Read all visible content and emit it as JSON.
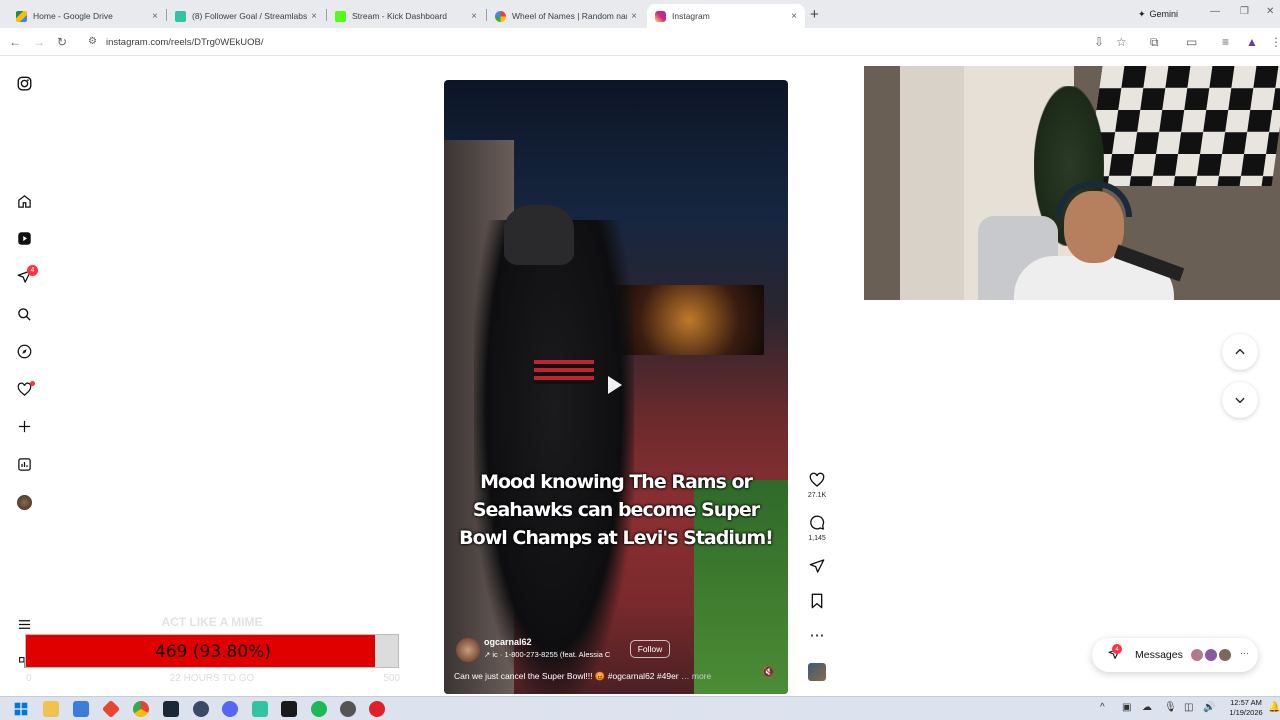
{
  "browser": {
    "tabs": [
      {
        "label": "Home - Google Drive",
        "close": "×",
        "favicon_color": "#1e8e3e"
      },
      {
        "label": "(8) Follower Goal / Streamlabs",
        "close": "×",
        "favicon_color": "#31c3a2"
      },
      {
        "label": "Stream - Kick Dashboard",
        "close": "×",
        "favicon_color": "#53fc18"
      },
      {
        "label": "Wheel of Names | Random nam",
        "close": "×",
        "favicon_color": "#4285f4"
      },
      {
        "label": "Instagram",
        "close": "×",
        "favicon_color": "#e1306c"
      }
    ],
    "new_tab": "+",
    "gemini_label": "Gemini",
    "url": "instagram.com/reels/DTrg0WEkUOB/"
  },
  "instagram": {
    "nav_badge_count": "4",
    "reel": {
      "overlay_text": "Mood knowing The Rams or Seahawks can become Super Bowl Champs at Levi's Stadium!",
      "username": "ogcarnal62",
      "audio": "↗ ic · 1-800-273-8255 (feat. Alessia C",
      "follow_label": "Follow",
      "caption": "Can we just cancel the Super Bowl!!! 😡 #ogcarnal62 #49er",
      "more_label": "… more"
    },
    "actions": {
      "likes": "27.1K",
      "comments": "1,145"
    },
    "messages": {
      "label": "Messages",
      "badge": "4",
      "avatar_colors": [
        "#b47a8a",
        "#8a5aa0",
        "#7a6a5a"
      ]
    }
  },
  "follower_goal": {
    "title": "ACT LIKE A MIME",
    "current": 469,
    "display": "469 (93.80%)",
    "progress": 0.938,
    "min": "0",
    "max": "500",
    "subtitle": "22 HOURS TO GO",
    "fill_color": "#e00000"
  },
  "taskbar": {
    "time": "12:57 AM",
    "date": "1/19/2026"
  }
}
